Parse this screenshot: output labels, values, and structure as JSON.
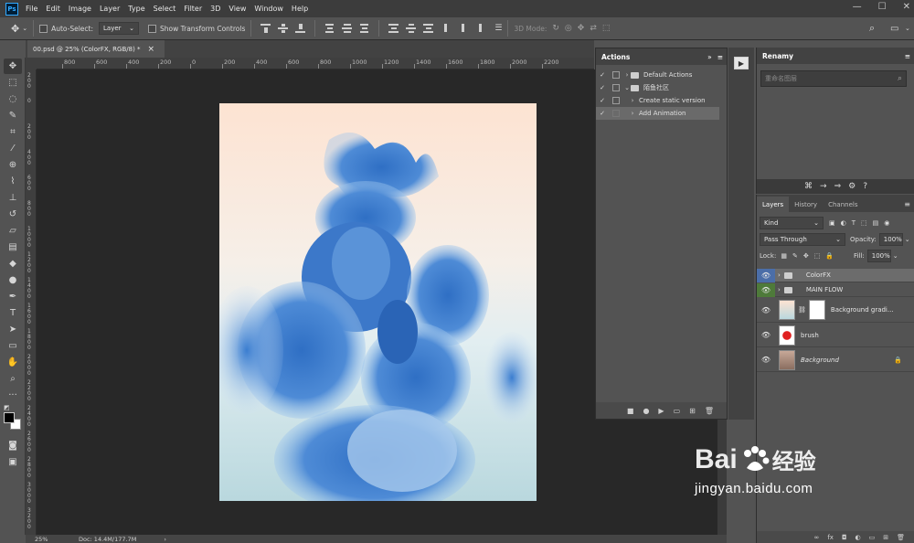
{
  "app": {
    "logo": "Ps"
  },
  "menubar": {
    "items": [
      "File",
      "Edit",
      "Image",
      "Layer",
      "Type",
      "Select",
      "Filter",
      "3D",
      "View",
      "Window",
      "Help"
    ]
  },
  "window_controls": {
    "minimize": "—",
    "maximize": "☐",
    "close": "✕"
  },
  "options_bar": {
    "auto_select_label": "Auto-Select:",
    "auto_select_value": "Layer",
    "show_transform_label": "Show Transform Controls",
    "mode_3d_label": "3D Mode:",
    "search_icon": "search-icon",
    "workspace_icon": "workspace-icon"
  },
  "document": {
    "tab_title": "00.psd @ 25% (ColorFX, RGB/8) *",
    "close_glyph": "×",
    "zoom": "25%",
    "doc_info": "Doc: 14.4M/177.7M"
  },
  "ruler": {
    "h_labels": [
      "800",
      "600",
      "400",
      "200",
      "0",
      "200",
      "400",
      "600",
      "800",
      "1000",
      "1200",
      "1400",
      "1600",
      "1800",
      "2000",
      "2200"
    ],
    "v_labels": [
      "200",
      "0",
      "200",
      "400",
      "600",
      "800",
      "1000",
      "1200",
      "1400",
      "1600",
      "1800",
      "2000",
      "2200",
      "2400",
      "2600",
      "2800",
      "3000",
      "3200"
    ]
  },
  "actions_panel": {
    "title": "Actions",
    "menu_glyph": "≡",
    "collapse_glyph": "»",
    "rows": [
      {
        "check": "✓",
        "chevron": "›",
        "folder": true,
        "label": "Default Actions",
        "indent": 0
      },
      {
        "check": "✓",
        "chevron": "⌄",
        "folder": true,
        "label": "陌鱼社区",
        "indent": 0
      },
      {
        "check": "✓",
        "chevron": "›",
        "folder": false,
        "label": "Create static version",
        "indent": 1
      },
      {
        "check": "✓",
        "chevron": "›",
        "folder": false,
        "label": "Add Animation",
        "indent": 1
      }
    ],
    "footer": [
      "■",
      "●",
      "▶",
      "▭",
      "⊞",
      "🗑"
    ]
  },
  "play_strip": {
    "play": "▶"
  },
  "renamy_panel": {
    "title": "Renamy",
    "menu_glyph": "≡",
    "input_placeholder": "重命名图层",
    "tools": [
      "⌘",
      "→",
      "⇒",
      "⚙",
      "?"
    ]
  },
  "layers_panel": {
    "tabs": [
      "Layers",
      "History",
      "Channels"
    ],
    "menu_glyph": "≡",
    "filter_kind": "Kind",
    "blend_mode": "Pass Through",
    "opacity_label": "Opacity:",
    "opacity_value": "100%",
    "lock_label": "Lock:",
    "fill_label": "Fill:",
    "fill_value": "100%",
    "layers": [
      {
        "name": "ColorFX",
        "type": "group",
        "eye_color": "#4b6ea8",
        "selected": true
      },
      {
        "name": "MAIN FLOW",
        "type": "group",
        "eye_color": "#4e7a3a",
        "selected": false
      },
      {
        "name": "Background gradi...",
        "type": "gradient",
        "eye_color": "",
        "selected": false
      },
      {
        "name": "brush",
        "type": "brush",
        "eye_color": "",
        "selected": false
      },
      {
        "name": "Background",
        "type": "background",
        "eye_color": "",
        "selected": false,
        "locked": true
      }
    ],
    "footer": [
      "∞",
      "fx",
      "◘",
      "◐",
      "▭",
      "⊞",
      "🗑"
    ]
  },
  "watermark": {
    "brand": "Bai",
    "brand2": "经验",
    "url": "jingyan.baidu.com"
  }
}
